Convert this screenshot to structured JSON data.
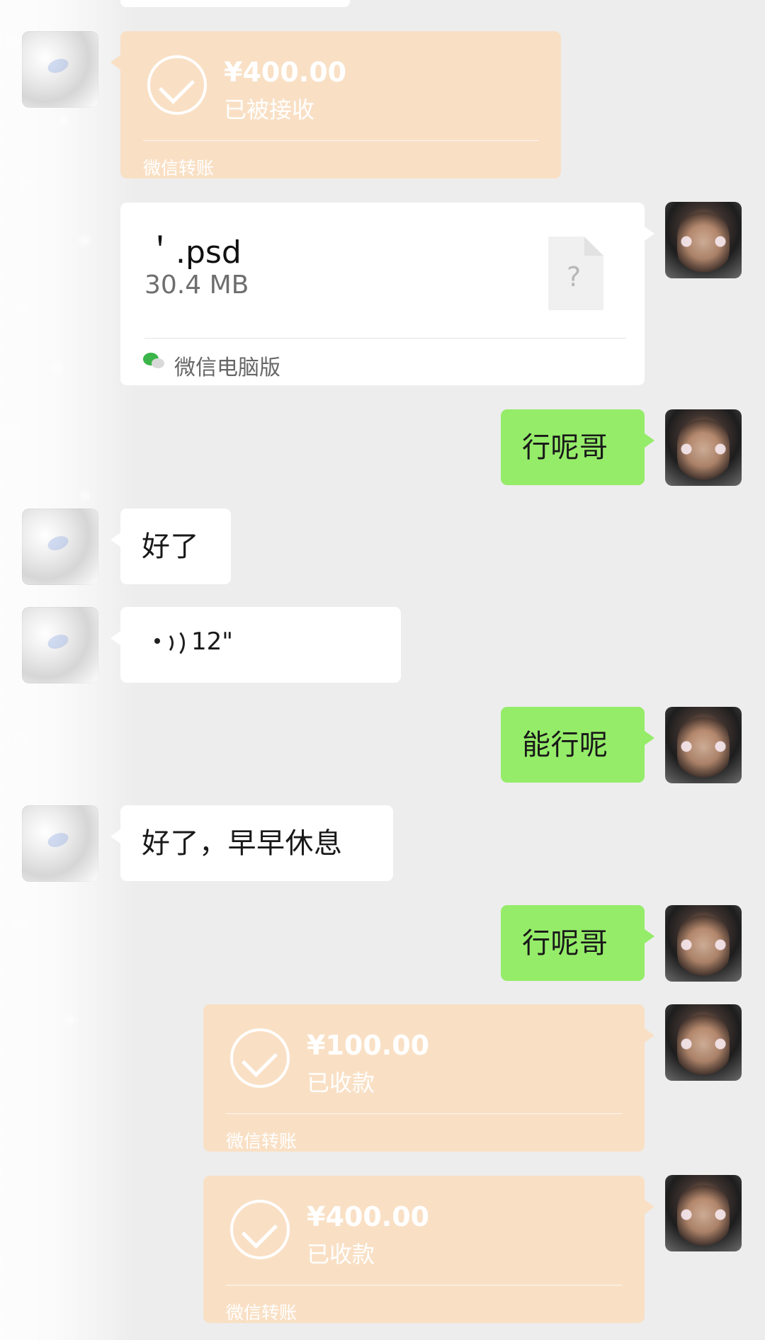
{
  "chat": {
    "top_transfer": {
      "amount": "¥400.00",
      "status": "已被接收",
      "footer": "微信转账",
      "icon": "check-circle-icon"
    },
    "file_message": {
      "filename": "＇.psd",
      "size": "30.4 MB",
      "file_icon": "question-file-icon",
      "file_icon_text": "?",
      "source": "微信电脑版",
      "source_icon": "wechat-icon"
    },
    "messages": [
      {
        "type": "text",
        "side": "right",
        "text": "行呢哥"
      },
      {
        "type": "text",
        "side": "left",
        "text": "好了"
      },
      {
        "type": "voice",
        "side": "left",
        "duration": "12\""
      },
      {
        "type": "text",
        "side": "right",
        "text": "能行呢"
      },
      {
        "type": "text",
        "side": "left",
        "text": "好了，早早休息"
      },
      {
        "type": "text",
        "side": "right",
        "text": "行呢哥"
      }
    ],
    "transfers_right": [
      {
        "amount": "¥100.00",
        "status": "已收款",
        "footer": "微信转账",
        "icon": "check-circle-icon"
      },
      {
        "amount": "¥400.00",
        "status": "已收款",
        "footer": "微信转账",
        "icon": "check-circle-icon"
      }
    ]
  },
  "colors": {
    "background": "#ededed",
    "green_bubble": "#95ec69",
    "white_bubble": "#ffffff",
    "transfer_bubble": "#f9e0c5"
  }
}
